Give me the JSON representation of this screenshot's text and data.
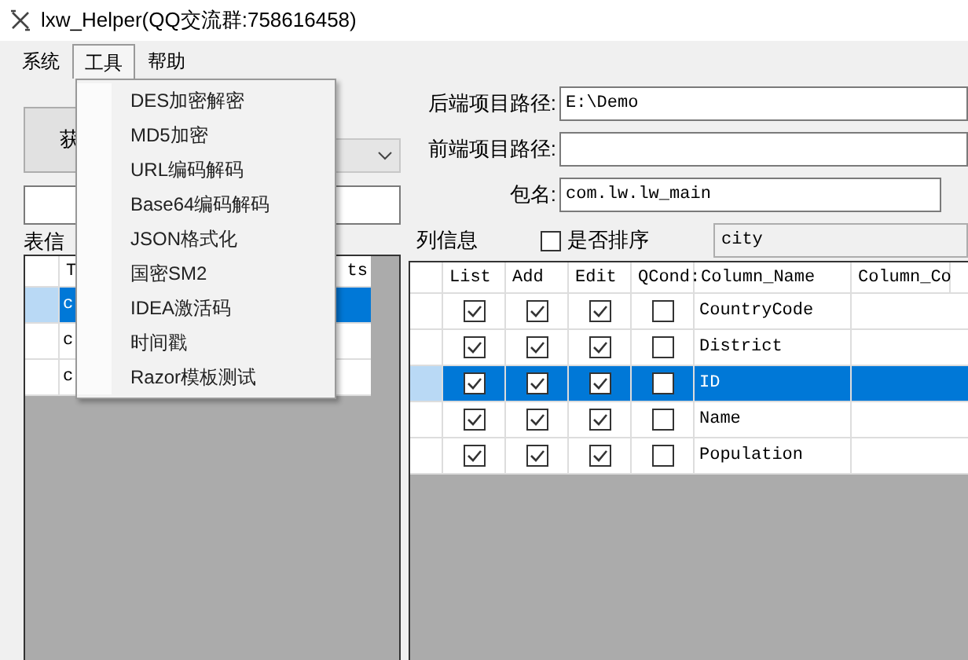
{
  "window": {
    "title": "lxw_Helper(QQ交流群:758616458)"
  },
  "menu_bar": [
    {
      "label": "系统",
      "selected": false
    },
    {
      "label": "工具",
      "selected": true
    },
    {
      "label": "帮助",
      "selected": false
    }
  ],
  "tools_menu": {
    "items": [
      "DES加密解密",
      "MD5加密",
      "URL编码解码",
      "Base64编码解码",
      "JSON格式化",
      "国密SM2",
      "IDEA激活码",
      "时间戳",
      "Razor模板测试"
    ]
  },
  "left_panel": {
    "button": "获",
    "table_label": "表信",
    "table": {
      "columns": [
        "T",
        "ts"
      ],
      "rows": [
        {
          "cells": [
            "c"
          ],
          "selected": true
        },
        {
          "cells": [
            "c"
          ],
          "selected": false
        },
        {
          "cells": [
            "c"
          ],
          "selected": false
        }
      ]
    }
  },
  "right_panel": {
    "fields": [
      {
        "label": "后端项目路径:",
        "value": "E:\\Demo"
      },
      {
        "label": "前端项目路径:"
      },
      {
        "label": "包名:",
        "value": "com.lw.lw_main"
      }
    ],
    "column_info_label": "列信息",
    "sort_checkbox": {
      "label": "是否排序",
      "checked": false
    },
    "table_field": {
      "value": "city"
    },
    "columns_table": {
      "columns": [
        "List",
        "Add",
        "Edit",
        "QCond:",
        "Column_Name",
        "Column_Co"
      ],
      "rows": [
        {
          "list": true,
          "add": true,
          "edit": true,
          "qcond": false,
          "column_name": "CountryCode",
          "selected": false
        },
        {
          "list": true,
          "add": true,
          "edit": true,
          "qcond": false,
          "column_name": "District",
          "selected": false
        },
        {
          "list": true,
          "add": true,
          "edit": true,
          "qcond": false,
          "column_name": "ID",
          "selected": true
        },
        {
          "list": true,
          "add": true,
          "edit": true,
          "qcond": false,
          "column_name": "Name",
          "selected": false
        },
        {
          "list": true,
          "add": true,
          "edit": true,
          "qcond": false,
          "column_name": "Population",
          "selected": false
        }
      ]
    }
  }
}
